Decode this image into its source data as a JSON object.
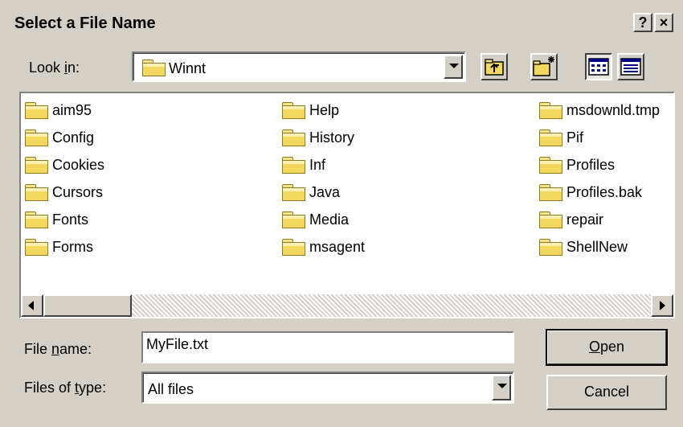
{
  "window": {
    "title": "Select a File Name",
    "help_button": "?",
    "close_button": "×"
  },
  "look_in": {
    "label_pre": "Look ",
    "label_u": "i",
    "label_post": "n:",
    "value": "Winnt"
  },
  "toolbar": {
    "up_icon": "up-one-level-icon",
    "new_folder_icon": "create-new-folder-icon",
    "list_icon": "list-view-icon",
    "details_icon": "details-view-icon"
  },
  "files": {
    "columns": [
      [
        "aim95",
        "Config",
        "Cookies",
        "Cursors",
        "Fonts",
        "Forms"
      ],
      [
        "Help",
        "History",
        "Inf",
        "Java",
        "Media",
        "msagent"
      ],
      [
        "msdownld.tmp",
        "Pif",
        "Profiles",
        "Profiles.bak",
        "repair",
        "ShellNew"
      ]
    ]
  },
  "file_name": {
    "label_pre": "File ",
    "label_u": "n",
    "label_post": "ame:",
    "value": "MyFile.txt"
  },
  "file_type": {
    "label_pre": "Files of ",
    "label_u": "t",
    "label_post": "ype:",
    "value": "All files"
  },
  "buttons": {
    "open_u": "O",
    "open_rest": "pen",
    "cancel": "Cancel"
  },
  "colors": {
    "dialog_face": "#d4d0c8",
    "folder_yellow": "#f3d860"
  }
}
